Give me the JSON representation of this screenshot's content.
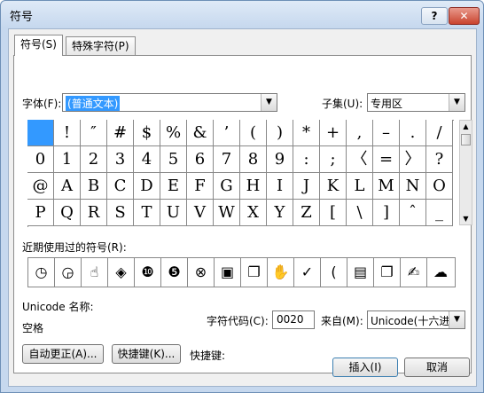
{
  "window": {
    "title": "符号",
    "help_label": "?",
    "close_label": "✕"
  },
  "tabs": [
    {
      "label": "符号(S)",
      "active": true
    },
    {
      "label": "特殊字符(P)",
      "active": false
    }
  ],
  "font": {
    "label": "字体(F):",
    "value": "(普通文本)"
  },
  "subset": {
    "label": "子集(U):",
    "value": "专用区"
  },
  "symbol_grid": {
    "rows": [
      [
        "",
        "!",
        "″",
        "#",
        "$",
        "%",
        "&",
        "’",
        "(",
        ")",
        "*",
        "+",
        ",",
        "–",
        ".",
        "/"
      ],
      [
        "0",
        "1",
        "2",
        "3",
        "4",
        "5",
        "6",
        "7",
        "8",
        "9",
        ":",
        ";",
        "〈",
        "=",
        "〉",
        "?"
      ],
      [
        "@",
        "A",
        "B",
        "C",
        "D",
        "E",
        "F",
        "G",
        "H",
        "I",
        "J",
        "K",
        "L",
        "M",
        "N",
        "O"
      ],
      [
        "P",
        "Q",
        "R",
        "S",
        "T",
        "U",
        "V",
        "W",
        "X",
        "Y",
        "Z",
        "[",
        "\\",
        "]",
        "ˆ",
        "_"
      ]
    ],
    "selected": "0,0"
  },
  "recent": {
    "label": "近期使用过的符号(R):",
    "items": [
      "◷",
      "◶",
      "☝",
      "◈",
      "❿",
      "❺",
      "⊗",
      "▣",
      "❐",
      "✋",
      "✓",
      "(",
      "▤",
      "❐",
      "✍",
      "☁"
    ]
  },
  "unicode_name": {
    "label": "Unicode 名称:",
    "value": "空格"
  },
  "char_code": {
    "label": "字符代码(C):",
    "value": "0020"
  },
  "from": {
    "label": "来自(M):",
    "value": "Unicode(十六进"
  },
  "buttons": {
    "autocorrect": "自动更正(A)...",
    "shortcut_key": "快捷键(K)...",
    "shortcut_label": "快捷键:",
    "insert": "插入(I)",
    "cancel": "取消"
  }
}
